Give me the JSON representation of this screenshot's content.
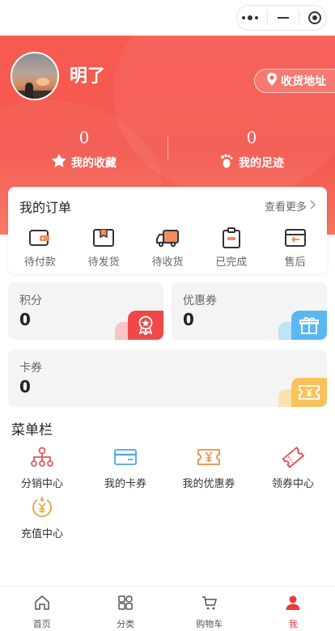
{
  "user": {
    "name": "明了",
    "address_label": "收货地址"
  },
  "stats": {
    "favorites": {
      "count": "0",
      "label": "我的收藏",
      "icon": "star-icon"
    },
    "footprints": {
      "count": "0",
      "label": "我的足迹",
      "icon": "footprint-icon"
    }
  },
  "orders": {
    "title": "我的订单",
    "more_label": "查看更多",
    "items": [
      {
        "label": "待付款",
        "icon": "wallet-icon"
      },
      {
        "label": "待发货",
        "icon": "package-icon"
      },
      {
        "label": "待收货",
        "icon": "truck-icon"
      },
      {
        "label": "已完成",
        "icon": "clipboard-icon"
      },
      {
        "label": "售后",
        "icon": "return-icon"
      }
    ]
  },
  "cards": {
    "points": {
      "label": "积分",
      "value": "0",
      "icon": "award-icon",
      "color": "#f04848"
    },
    "coupons": {
      "label": "优惠券",
      "value": "0",
      "icon": "gift-icon",
      "color": "#5ab8f0"
    },
    "vouchers": {
      "label": "卡券",
      "value": "0",
      "icon": "ticket-icon",
      "color": "#f7c35a"
    }
  },
  "menu": {
    "title": "菜单栏",
    "items": [
      {
        "label": "分销中心",
        "icon": "distribution-icon",
        "color": "#e05a5a"
      },
      {
        "label": "我的卡券",
        "icon": "card-icon",
        "color": "#4aa8d8"
      },
      {
        "label": "我的优惠券",
        "icon": "coupon-icon",
        "color": "#e8904a"
      },
      {
        "label": "领券中心",
        "icon": "voucher-center-icon",
        "color": "#e84a4a"
      },
      {
        "label": "充值中心",
        "icon": "recharge-icon",
        "color": "#e8a040"
      }
    ]
  },
  "nav": {
    "items": [
      {
        "label": "首页",
        "icon": "home-icon",
        "active": false
      },
      {
        "label": "分类",
        "icon": "category-icon",
        "active": false
      },
      {
        "label": "购物车",
        "icon": "cart-icon",
        "active": false
      },
      {
        "label": "我",
        "icon": "user-icon",
        "active": true
      }
    ]
  },
  "colors": {
    "primary": "#f4584e",
    "active_nav": "#e63c3c"
  }
}
